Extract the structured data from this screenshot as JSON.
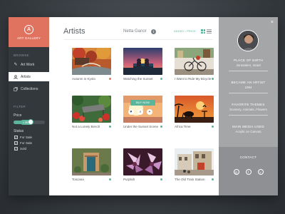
{
  "app": {
    "brand_logo": "A",
    "brand_name": "ART GALLERY"
  },
  "sidebar": {
    "browse_title": "BROWSE",
    "items": [
      {
        "label": "Art Work",
        "icon": "brush-icon"
      },
      {
        "label": "Artists",
        "icon": "user-icon",
        "active": true
      },
      {
        "label": "Collections",
        "icon": "collections-icon"
      }
    ],
    "filter_title": "FILTER",
    "price_label": "Price",
    "price_value": "< $50",
    "price_fraction": 0.55,
    "status_label": "Status",
    "statuses": [
      {
        "label": "For Sale",
        "checked": true
      },
      {
        "label": "For Sale",
        "checked": true
      },
      {
        "label": "Sold",
        "checked": true
      }
    ]
  },
  "main": {
    "title": "Artists",
    "artist_name": "Netta Ganor",
    "sort_label": "ADDED • PRICE",
    "buy_now_label": "BUY NOW",
    "artworks": [
      {
        "title": "Autumn in Kyoto",
        "status_color": "#e0735f"
      },
      {
        "title": "Watching the Sunset",
        "status_color": "#5ab59a"
      },
      {
        "title": "I Want to Ride My Bicycle",
        "status_color": "#5ab59a"
      },
      {
        "title": "Not a Lonely Bench",
        "status_color": "#5ab59a"
      },
      {
        "title": "Under the Sunset Scene",
        "status_color": "#5ab59a"
      },
      {
        "title": "Africa Time",
        "status_color": "#5ab59a"
      },
      {
        "title": "Toscana",
        "status_color": "#5ab59a"
      },
      {
        "title": "Purplish",
        "status_color": "#5ab59a"
      },
      {
        "title": "The Old Train Station",
        "status_color": "#5ab59a"
      }
    ]
  },
  "profile": {
    "close": "×",
    "born_label": "PLACE OF BIRTH",
    "born_value": "Jerusalem, Israel",
    "artist_label": "BECAME AN ARTIST",
    "artist_value": "1994",
    "themes_label": "FAVORITE THEMES",
    "themes_value": "Scenery, Animals, Flowers",
    "media_label": "MAIN MEDIA USED",
    "media_value": "Acrylic on Canvas",
    "contact_title": "CONTACT",
    "social": [
      "instagram-icon",
      "facebook-icon",
      "vine-icon"
    ]
  },
  "colors": {
    "accent": "#5ab59a",
    "brand": "#e0735f",
    "sidebar": "#33383d",
    "panel": "#a4a6a8"
  }
}
